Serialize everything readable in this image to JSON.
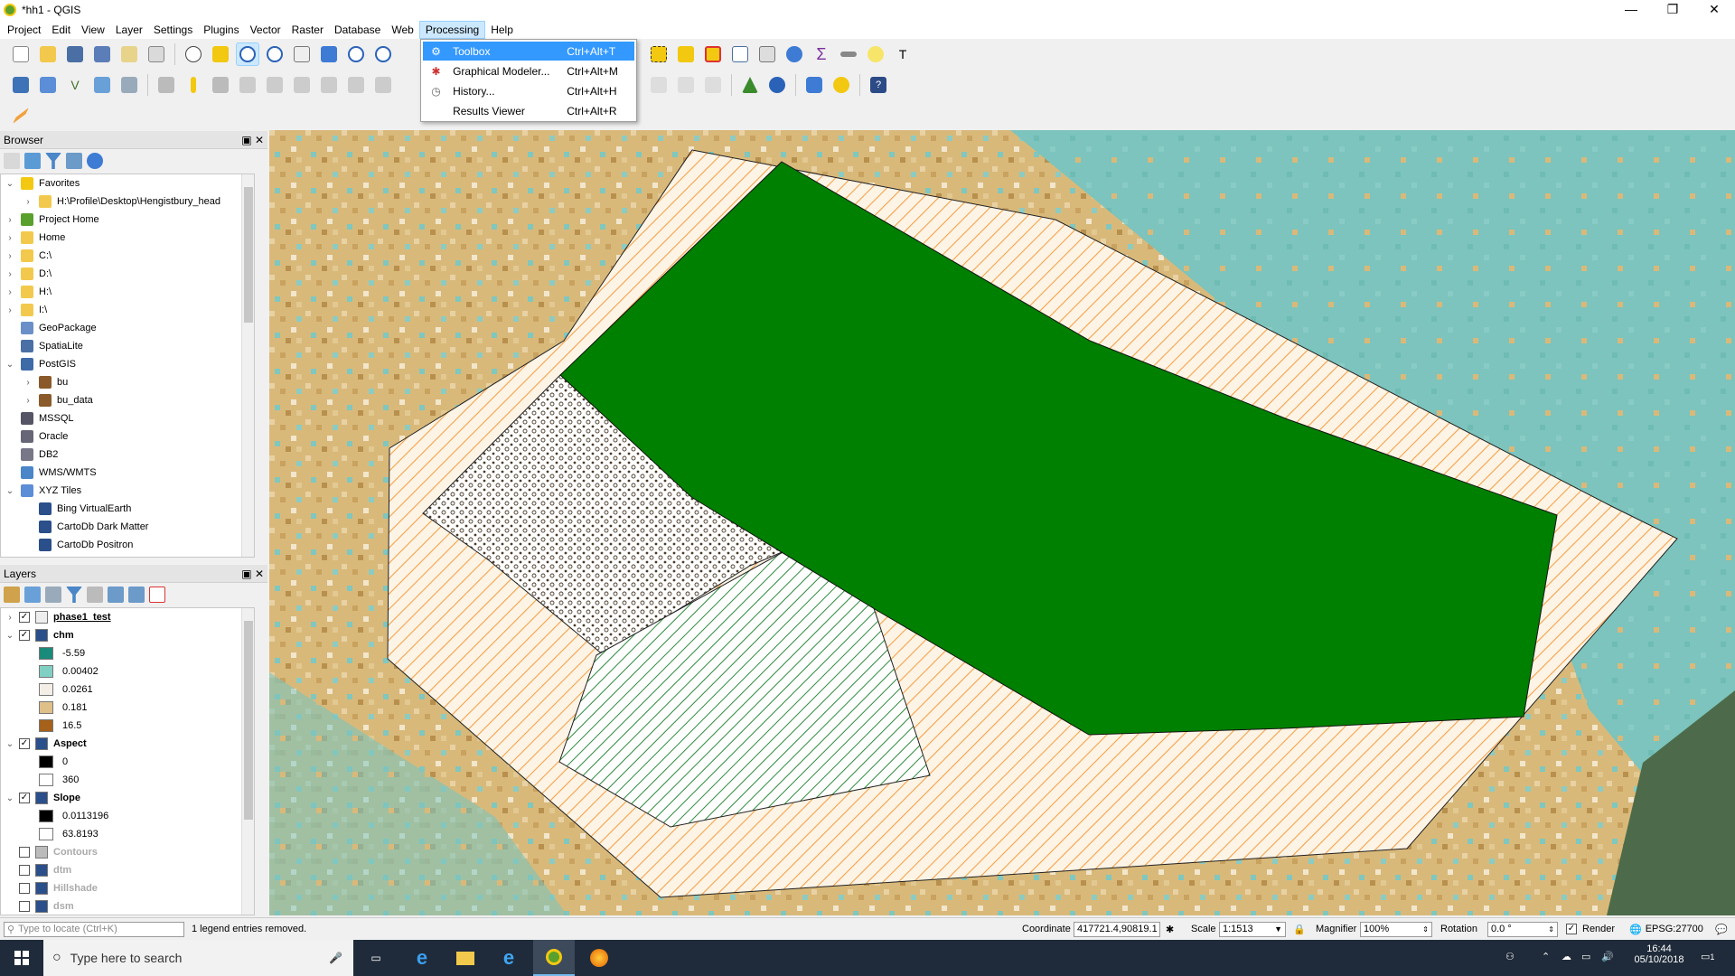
{
  "window": {
    "title": "*hh1 - QGIS",
    "controls": [
      "—",
      "❐",
      "✕"
    ]
  },
  "menu": [
    "Project",
    "Edit",
    "View",
    "Layer",
    "Settings",
    "Plugins",
    "Vector",
    "Raster",
    "Database",
    "Web",
    "Processing",
    "Help"
  ],
  "processing_menu": [
    {
      "label": "Toolbox",
      "shortcut": "Ctrl+Alt+T",
      "icon": "gear-icon"
    },
    {
      "label": "Graphical Modeler...",
      "shortcut": "Ctrl+Alt+M",
      "icon": "model-icon"
    },
    {
      "label": "History...",
      "shortcut": "Ctrl+Alt+H",
      "icon": "history-icon"
    },
    {
      "label": "Results Viewer",
      "shortcut": "Ctrl+Alt+R",
      "icon": "results-icon"
    }
  ],
  "browser": {
    "title": "Browser",
    "items": [
      {
        "label": "Favorites",
        "icon": "star-icon",
        "level": 0,
        "arrow": "⌄"
      },
      {
        "label": "H:\\Profile\\Desktop\\Hengistbury_head",
        "icon": "folder-icon",
        "level": 1,
        "arrow": "›"
      },
      {
        "label": "Project Home",
        "icon": "project-home-icon",
        "level": 0,
        "arrow": "›"
      },
      {
        "label": "Home",
        "icon": "folder-icon",
        "level": 0,
        "arrow": "›"
      },
      {
        "label": "C:\\",
        "icon": "folder-icon",
        "level": 0,
        "arrow": "›"
      },
      {
        "label": "D:\\",
        "icon": "folder-icon",
        "level": 0,
        "arrow": "›"
      },
      {
        "label": "H:\\",
        "icon": "folder-icon",
        "level": 0,
        "arrow": "›"
      },
      {
        "label": "I:\\",
        "icon": "folder-icon",
        "level": 0,
        "arrow": "›"
      },
      {
        "label": "GeoPackage",
        "icon": "geopackage-icon",
        "level": 0,
        "arrow": ""
      },
      {
        "label": "SpatiaLite",
        "icon": "spatialite-icon",
        "level": 0,
        "arrow": ""
      },
      {
        "label": "PostGIS",
        "icon": "postgis-icon",
        "level": 0,
        "arrow": "⌄"
      },
      {
        "label": "bu",
        "icon": "connection-icon",
        "level": 1,
        "arrow": "›"
      },
      {
        "label": "bu_data",
        "icon": "connection-icon",
        "level": 1,
        "arrow": "›"
      },
      {
        "label": "MSSQL",
        "icon": "mssql-icon",
        "level": 0,
        "arrow": ""
      },
      {
        "label": "Oracle",
        "icon": "oracle-icon",
        "level": 0,
        "arrow": ""
      },
      {
        "label": "DB2",
        "icon": "db2-icon",
        "level": 0,
        "arrow": ""
      },
      {
        "label": "WMS/WMTS",
        "icon": "globe-icon",
        "level": 0,
        "arrow": ""
      },
      {
        "label": "XYZ Tiles",
        "icon": "xyz-tiles-icon",
        "level": 0,
        "arrow": "⌄"
      },
      {
        "label": "Bing VirtualEarth",
        "icon": "tile-icon",
        "level": 1,
        "arrow": ""
      },
      {
        "label": "CartoDb Dark Matter",
        "icon": "tile-icon",
        "level": 1,
        "arrow": ""
      },
      {
        "label": "CartoDb Positron",
        "icon": "tile-icon",
        "level": 1,
        "arrow": ""
      }
    ]
  },
  "layers": {
    "title": "Layers",
    "items": [
      {
        "type": "layer",
        "label": "phase1_test",
        "checked": true,
        "arrow": "›",
        "icon": "polygon-layer-icon",
        "style": "bold-underline"
      },
      {
        "type": "layer",
        "label": "chm",
        "checked": true,
        "arrow": "⌄",
        "icon": "raster-icon",
        "style": "bold"
      },
      {
        "type": "legend",
        "label": "-5.59",
        "color": "#1a8a7a"
      },
      {
        "type": "legend",
        "label": "0.00402",
        "color": "#7fd0c3"
      },
      {
        "type": "legend",
        "label": "0.0261",
        "color": "#f4efe6"
      },
      {
        "type": "legend",
        "label": "0.181",
        "color": "#dfc089"
      },
      {
        "type": "legend",
        "label": "16.5",
        "color": "#a6611a"
      },
      {
        "type": "layer",
        "label": "Aspect",
        "checked": true,
        "arrow": "⌄",
        "icon": "raster-icon",
        "style": "bold"
      },
      {
        "type": "legend",
        "label": "0",
        "color": "#000000"
      },
      {
        "type": "legend",
        "label": "360",
        "color": "#ffffff"
      },
      {
        "type": "layer",
        "label": "Slope",
        "checked": true,
        "arrow": "⌄",
        "icon": "raster-icon",
        "style": "bold"
      },
      {
        "type": "legend",
        "label": "0.0113196",
        "color": "#000000"
      },
      {
        "type": "legend",
        "label": "63.8193",
        "color": "#ffffff"
      },
      {
        "type": "layer",
        "label": "Contours",
        "checked": false,
        "arrow": "",
        "icon": "line-layer-icon",
        "style": "dim"
      },
      {
        "type": "layer",
        "label": "dtm",
        "checked": false,
        "arrow": "",
        "icon": "raster-icon",
        "style": "dim"
      },
      {
        "type": "layer",
        "label": "Hillshade",
        "checked": false,
        "arrow": "",
        "icon": "raster-icon",
        "style": "dim"
      },
      {
        "type": "layer",
        "label": "dsm",
        "checked": false,
        "arrow": "",
        "icon": "raster-icon",
        "style": "dim"
      }
    ]
  },
  "status": {
    "locate_placeholder": "Type to locate (Ctrl+K)",
    "message": "1 legend entries removed.",
    "coordinate_label": "Coordinate",
    "coordinate_value": "417721.4,90819.1",
    "scale_label": "Scale",
    "scale_value": "1:1513",
    "magnifier_label": "Magnifier",
    "magnifier_value": "100%",
    "rotation_label": "Rotation",
    "rotation_value": "0.0 °",
    "render_label": "Render",
    "render_checked": true,
    "crs": "EPSG:27700"
  },
  "taskbar": {
    "search_placeholder": "Type here to search",
    "time": "16:44",
    "date": "05/10/2018",
    "notification_count": "1"
  },
  "colors": {
    "map_green": "#008000",
    "hatch_orange": "#f5a24a",
    "sand": "#d9b97a",
    "water": "#7cc4bd",
    "menu_highlight": "#3399ff"
  }
}
